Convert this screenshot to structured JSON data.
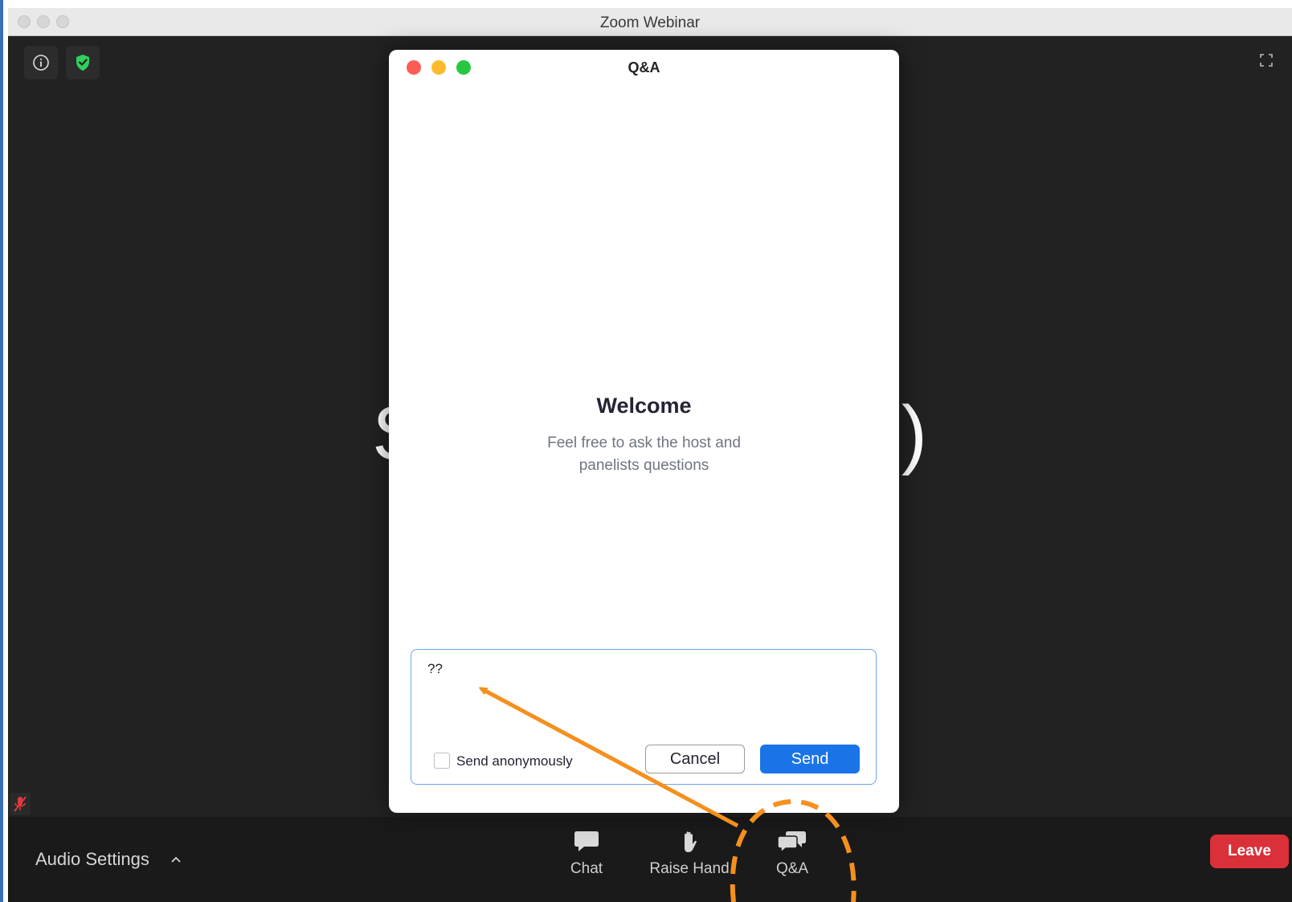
{
  "window": {
    "title": "Zoom Webinar"
  },
  "stage": {
    "speaker_name": "Stephen (NCBI)"
  },
  "dialog": {
    "title": "Q&A",
    "welcome_title": "Welcome",
    "welcome_line1": "Feel free to ask the host and",
    "welcome_line2": "panelists questions",
    "question_value": "??",
    "anonymous_label": "Send anonymously",
    "cancel_label": "Cancel",
    "send_label": "Send"
  },
  "toolbar": {
    "audio_settings_label": "Audio Settings",
    "chat_label": "Chat",
    "raise_hand_label": "Raise Hand",
    "qa_label": "Q&A",
    "leave_label": "Leave"
  },
  "colors": {
    "accent_blue": "#1a74e8",
    "leave_red": "#d9303a",
    "annotation_orange": "#f5901e",
    "shield_green": "#2fd05b"
  },
  "icons": [
    "info-icon",
    "shield-check-icon",
    "fullscreen-icon",
    "mic-muted-icon",
    "chevron-up-icon",
    "chat-icon",
    "raise-hand-icon",
    "qa-icon"
  ]
}
